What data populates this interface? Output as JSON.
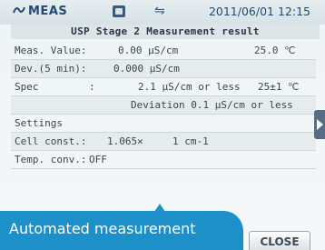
{
  "statusbar": {
    "brand": "MEAS",
    "datetime": "2011/06/01 12:15"
  },
  "title": "USP Stage 2 Measurement result",
  "rows": {
    "meas_value": {
      "label": "Meas. Value:",
      "value1": "0.00 µS/cm",
      "value2": "25.0 ℃"
    },
    "dev": {
      "label": "Dev.(5 min):",
      "value1": "0.000 µS/cm"
    },
    "spec": {
      "label": "Spec",
      "sep": ":",
      "value1": "2.1 µS/cm or less",
      "value2": "25±1 ℃"
    },
    "deviation": {
      "value1": "Deviation 0.1 µS/cm or less"
    },
    "settings": {
      "label": "Settings"
    },
    "cell": {
      "label": "Cell const.:",
      "value1": "1.065×",
      "value2": "1 cm-1"
    },
    "temp": {
      "label": "Temp. conv.:",
      "value1": "OFF"
    }
  },
  "toolbar": {
    "close_label": "CLOSE"
  },
  "caption": "Automated measurement"
}
